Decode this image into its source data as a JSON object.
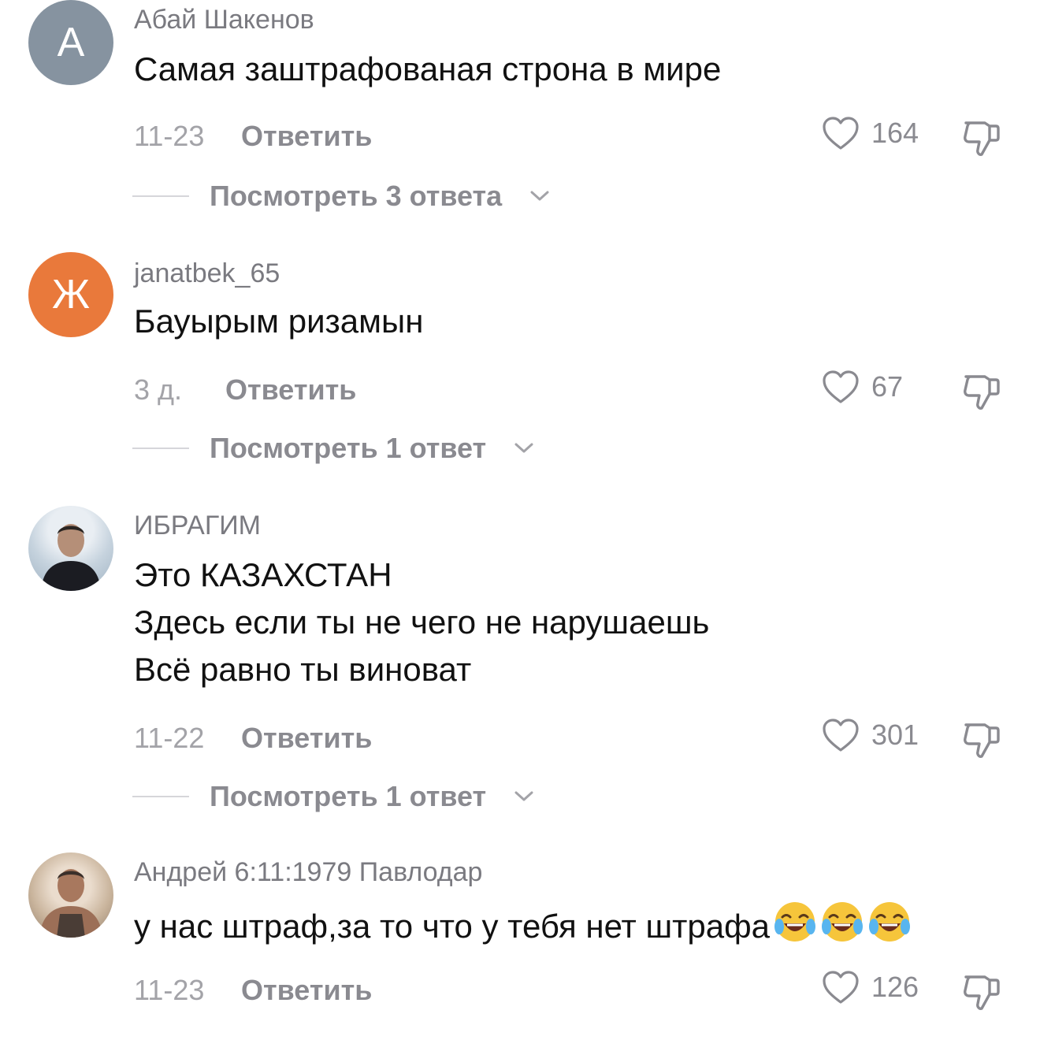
{
  "comments": [
    {
      "username": "Абай Шакенов",
      "avatar_letter": "A",
      "avatar_color": "#8693a0",
      "lines": [
        "Самая заштрафованая строна в мире"
      ],
      "date": "11-23",
      "reply_label": "Ответить",
      "likes": "164",
      "view_replies": "Посмотреть 3 ответа"
    },
    {
      "username": "janatbek_65",
      "avatar_letter": "Ж",
      "avatar_color": "#e9793b",
      "lines": [
        "Бауырым ризамын"
      ],
      "date": "3 д.",
      "reply_label": "Ответить",
      "likes": "67",
      "view_replies": "Посмотреть 1 ответ"
    },
    {
      "username": "ИБРАГИМ",
      "avatar_letter": "",
      "lines": [
        "Это КАЗАХСТАН",
        "Здесь если ты не чего не нарушаешь",
        "Всё равно ты виноват"
      ],
      "date": "11-22",
      "reply_label": "Ответить",
      "likes": "301",
      "view_replies": "Посмотреть 1 ответ"
    },
    {
      "username": "Андрей 6:11:1979 Павлодар",
      "avatar_letter": "",
      "lines": [
        "у нас штраф,за то что у тебя нет штрафа"
      ],
      "emoji": "laughing-crying-emoji",
      "emoji_count": 3,
      "date": "11-23",
      "reply_label": "Ответить",
      "likes": "126"
    }
  ],
  "icons": {
    "like": "heart-outline-icon",
    "dislike": "thumbs-down-outline-icon",
    "expand": "chevron-down-icon"
  },
  "colors": {
    "secondary_text": "#8a8a90",
    "meta_text": "#a3a3a8",
    "primary_text": "#111111"
  }
}
